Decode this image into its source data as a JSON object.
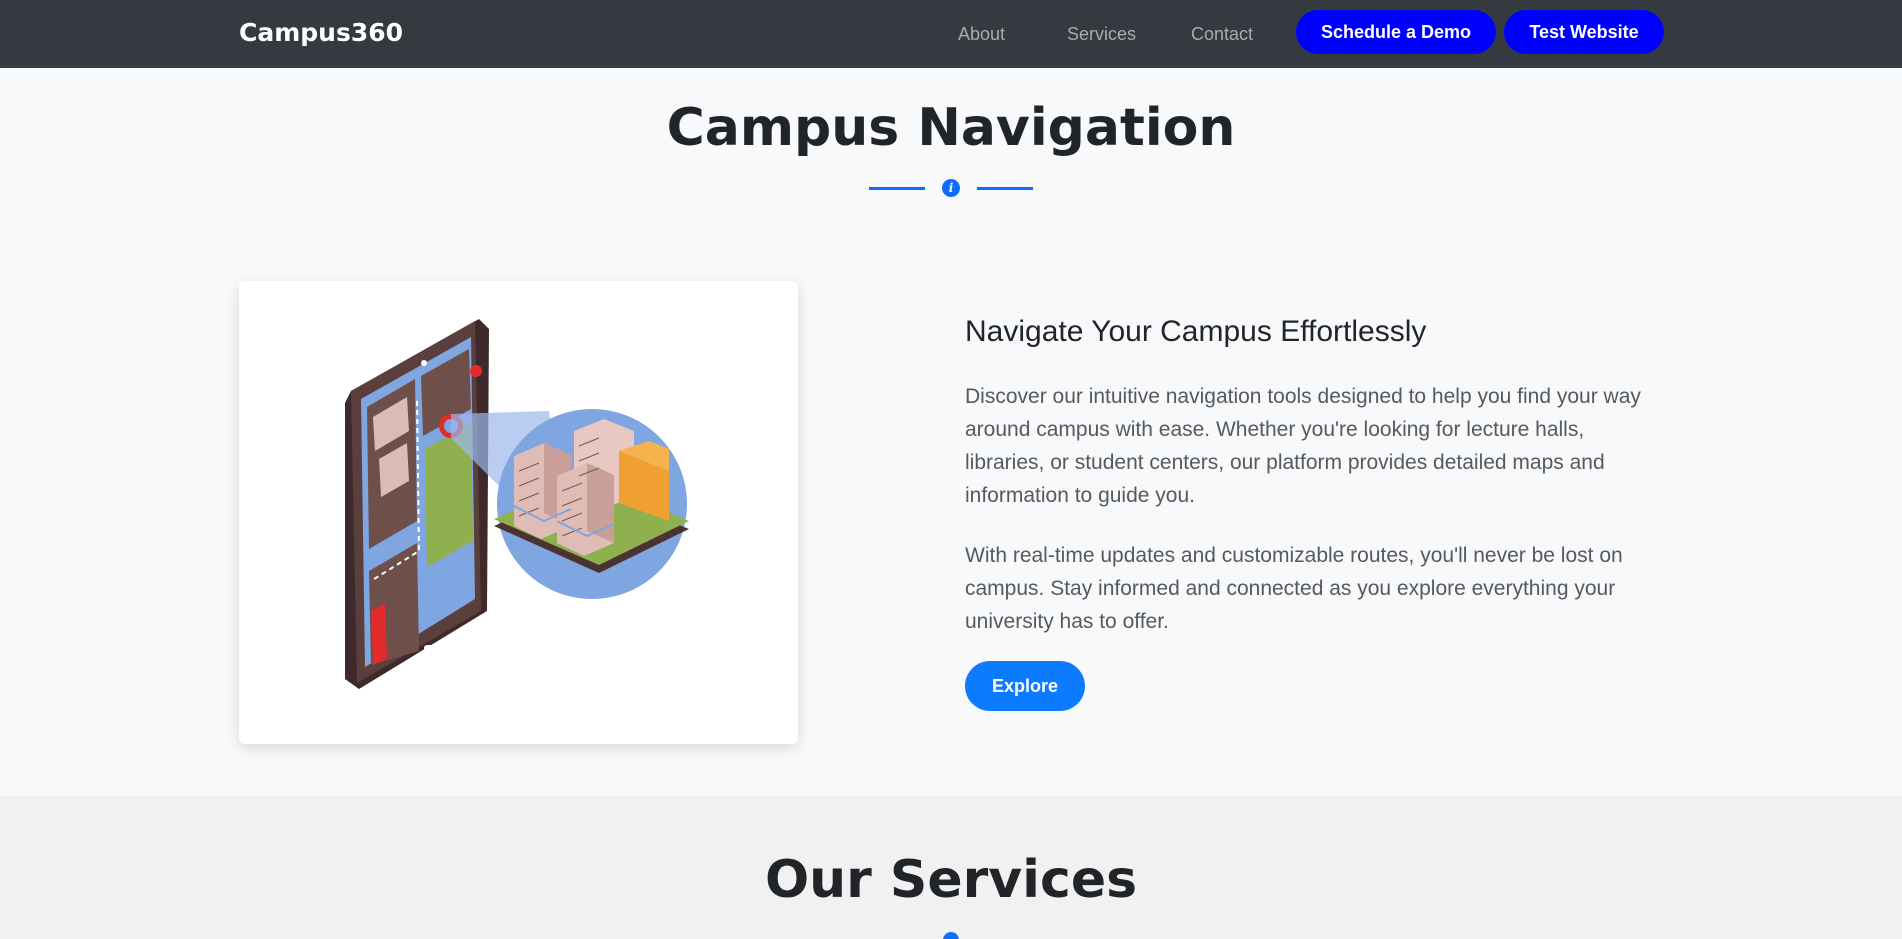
{
  "navbar": {
    "brand": "Campus360",
    "links": [
      "About",
      "Services",
      "Contact"
    ],
    "buttons": {
      "demo": "Schedule a Demo",
      "test": "Test Website"
    }
  },
  "navigation_section": {
    "title": "Campus Navigation",
    "divider_icon": "info-icon",
    "heading": "Navigate Your Campus Effortlessly",
    "paragraph1": "Discover our intuitive navigation tools designed to help you find your way around campus with ease. Whether you're looking for lecture halls, libraries, or student centers, our platform provides detailed maps and information to guide you.",
    "paragraph2": "With real-time updates and customizable routes, you'll never be lost on campus. Stay informed and connected as you explore everything your university has to offer.",
    "explore_label": "Explore",
    "image_icon": "phone-map-illustration"
  },
  "services_section": {
    "title": "Our Services"
  },
  "colors": {
    "navbar_bg": "#343a40",
    "nav_button": "#0000ff",
    "accent": "#0d6efd",
    "explore_button": "#0d7bff",
    "page_bg": "#f8f9fa",
    "services_bg": "#f1f1f1"
  }
}
